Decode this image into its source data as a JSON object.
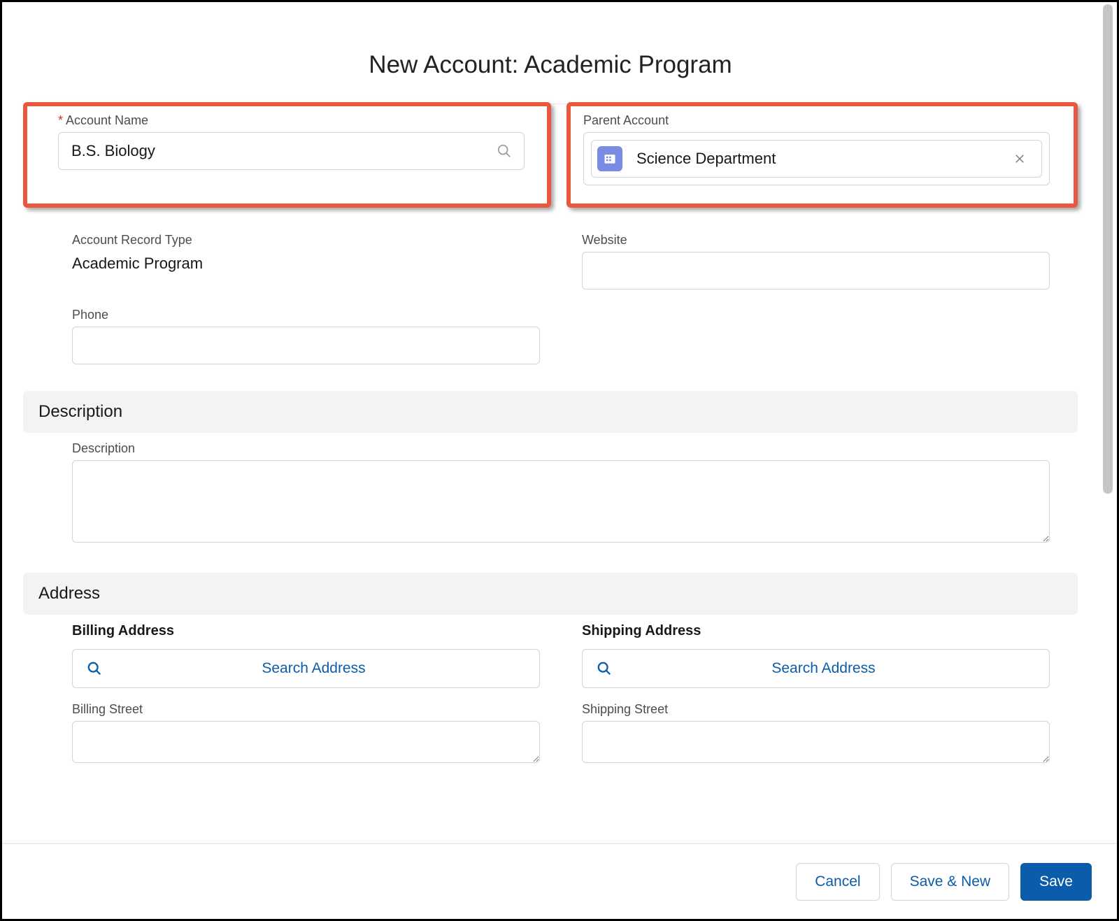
{
  "modal": {
    "title": "New Account: Academic Program"
  },
  "fields": {
    "account_name": {
      "label": "Account Name",
      "required_marker": "*",
      "value": "B.S. Biology"
    },
    "parent_account": {
      "label": "Parent Account",
      "selected_label": "Science Department",
      "icon_name": "account-icon"
    },
    "record_type": {
      "label": "Account Record Type",
      "value": "Academic Program"
    },
    "website": {
      "label": "Website",
      "value": ""
    },
    "phone": {
      "label": "Phone",
      "value": ""
    },
    "description_section": "Description",
    "description": {
      "label": "Description",
      "value": ""
    },
    "address_section": "Address",
    "billing": {
      "heading": "Billing Address",
      "search_label": "Search Address",
      "street_label": "Billing Street",
      "street_value": ""
    },
    "shipping": {
      "heading": "Shipping Address",
      "search_label": "Search Address",
      "street_label": "Shipping Street",
      "street_value": ""
    }
  },
  "footer": {
    "cancel": "Cancel",
    "save_new": "Save & New",
    "save": "Save"
  }
}
